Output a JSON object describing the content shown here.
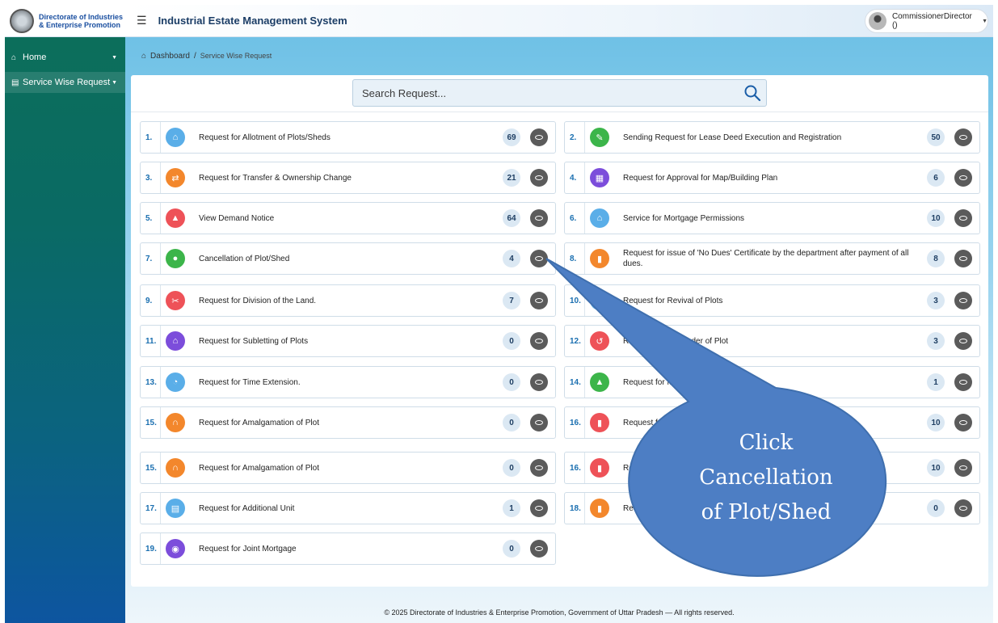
{
  "brand": {
    "line1": "Directorate of Industries",
    "line2": "& Enterprise Promotion"
  },
  "header": {
    "title": "Industrial Estate Management System",
    "user": "CommissionerDirector ()"
  },
  "sidebar": {
    "items": [
      {
        "label": "Home"
      },
      {
        "label": "Service Wise Request"
      }
    ]
  },
  "breadcrumb": {
    "home": "Dashboard",
    "separator": "/",
    "current": "Service Wise Request"
  },
  "search": {
    "placeholder": "Search Request..."
  },
  "services": [
    {
      "num": "1.",
      "title": "Request for Allotment of Plots/Sheds",
      "count": "69",
      "icon": "building-icon",
      "color": "#5aaee8"
    },
    {
      "num": "2.",
      "title": "Sending Request for Lease Deed Execution and Registration",
      "count": "50",
      "icon": "document-icon",
      "color": "#3cb54a"
    },
    {
      "num": "3.",
      "title": "Request for Transfer & Ownership Change",
      "count": "21",
      "icon": "transfer-icon",
      "color": "#f3872c"
    },
    {
      "num": "4.",
      "title": "Request for Approval for Map/Building Plan",
      "count": "6",
      "icon": "map-icon",
      "color": "#7c4ddb"
    },
    {
      "num": "5.",
      "title": "View Demand Notice",
      "count": "64",
      "icon": "bell-icon",
      "color": "#ee5258"
    },
    {
      "num": "6.",
      "title": "Service for Mortgage Permissions",
      "count": "10",
      "icon": "bank-icon",
      "color": "#5aaee8"
    },
    {
      "num": "7.",
      "title": "Cancellation of Plot/Shed",
      "count": "4",
      "icon": "cancel-circle-icon",
      "color": "#3cb54a"
    },
    {
      "num": "8.",
      "title": "Request for issue of 'No Dues' Certificate by the department after payment of all dues.",
      "count": "8",
      "icon": "file-icon",
      "color": "#f3872c"
    },
    {
      "num": "9.",
      "title": "Request for Division of the Land.",
      "count": "7",
      "icon": "scissors-icon",
      "color": "#ee5258"
    },
    {
      "num": "10.",
      "title": "Request for Revival of Plots",
      "count": "3",
      "icon": "refresh-icon",
      "color": "#5aaee8"
    },
    {
      "num": "11.",
      "title": "Request for Subletting of Plots",
      "count": "0",
      "icon": "home-icon",
      "color": "#7c4ddb"
    },
    {
      "num": "12.",
      "title": "Request for Surrender of Plot",
      "count": "3",
      "icon": "undo-icon",
      "color": "#ee5258"
    },
    {
      "num": "13.",
      "title": "Request for Time Extension.",
      "count": "0",
      "icon": "clock-icon",
      "color": "#5aaee8"
    },
    {
      "num": "14.",
      "title": "Request for Maintenance of Parks",
      "count": "1",
      "icon": "tree-icon",
      "color": "#3cb54a"
    },
    {
      "num": "15.",
      "title": "Request for Amalgamation of Plot",
      "count": "0",
      "icon": "merge-icon",
      "color": "#f3872c"
    },
    {
      "num": "16.",
      "title": "Request for",
      "count": "10",
      "icon": "bookmark-icon",
      "color": "#ee5258"
    },
    {
      "num": "15.",
      "title": "Request for Amalgamation of Plot",
      "count": "0",
      "icon": "merge-icon",
      "color": "#f3872c"
    },
    {
      "num": "16.",
      "title": "Requ",
      "count": "10",
      "icon": "bookmark-icon",
      "color": "#ee5258"
    },
    {
      "num": "17.",
      "title": "Request for Additional Unit",
      "count": "1",
      "icon": "factory-icon",
      "color": "#5aaee8"
    },
    {
      "num": "18.",
      "title": "Reque",
      "count": "0",
      "icon": "file-icon",
      "color": "#f3872c"
    },
    {
      "num": "19.",
      "title": "Request for Joint Mortgage",
      "count": "0",
      "icon": "handshake-icon",
      "color": "#7c4ddb"
    }
  ],
  "callout": {
    "line1": "Click",
    "line2": "Cancellation",
    "line3": "of Plot/Shed",
    "color": "#4d7ec4"
  },
  "footer": {
    "text": "© 2025 Directorate of Industries & Enterprise Promotion, Government of Uttar Pradesh — All rights reserved."
  }
}
